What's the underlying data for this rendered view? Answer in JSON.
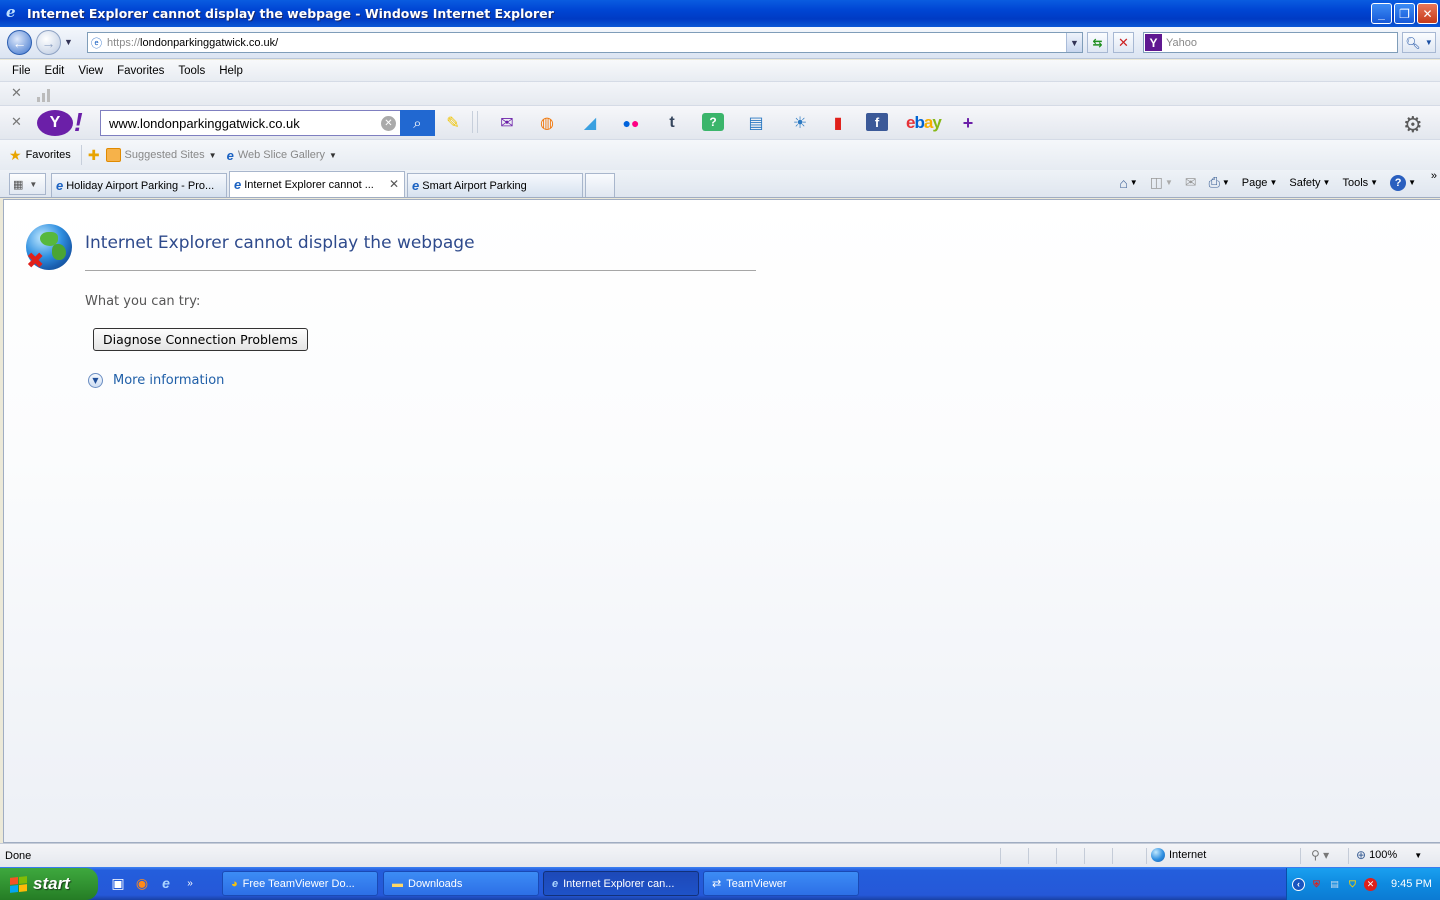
{
  "window": {
    "title": "Internet Explorer cannot display the webpage - Windows Internet Explorer",
    "minimize_icon": "minimize-icon",
    "restore_icon": "restore-icon",
    "close_icon": "close-icon"
  },
  "address": {
    "scheme": "https://",
    "host": "londonparkinggatwick.co.uk/",
    "search_placeholder": "Yahoo"
  },
  "menu": [
    "File",
    "Edit",
    "View",
    "Favorites",
    "Tools",
    "Help"
  ],
  "yahoo_toolbar": {
    "search_value": "www.londonparkinggatwick.co.uk",
    "ebay": {
      "e": "e",
      "b": "b",
      "a": "a",
      "y": "y"
    }
  },
  "favorites_bar": {
    "favorites_label": "Favorites",
    "suggested_sites": "Suggested Sites",
    "web_slice_gallery": "Web Slice Gallery"
  },
  "tabs": [
    {
      "label": "Holiday Airport Parking - Pro...",
      "active": false
    },
    {
      "label": "Internet Explorer cannot ...",
      "active": true
    },
    {
      "label": "Smart Airport Parking",
      "active": false
    }
  ],
  "command_bar": {
    "page": "Page",
    "safety": "Safety",
    "tools": "Tools",
    "help": "?"
  },
  "content": {
    "error_title": "Internet Explorer cannot display the webpage",
    "what_you_can_try": "What you can try:",
    "diagnose_button": "Diagnose Connection Problems",
    "more_information": "More information"
  },
  "status": {
    "text": "Done",
    "zone": "Internet",
    "zoom": "100%"
  },
  "taskbar": {
    "start": "start",
    "buttons": [
      {
        "label": "Free TeamViewer Do...",
        "active": false
      },
      {
        "label": "Downloads",
        "active": false
      },
      {
        "label": "Internet Explorer can...",
        "active": true
      },
      {
        "label": "TeamViewer",
        "active": false
      }
    ],
    "clock": "9:45 PM"
  },
  "colors": {
    "title_blue": "#0046d4",
    "link_blue": "#1f5fa8",
    "error_title": "#2e4a8c",
    "start_green": "#2f8f2f",
    "yahoo_purple": "#6b1fa8"
  }
}
